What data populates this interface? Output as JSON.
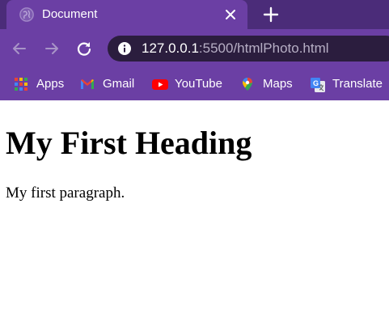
{
  "tab": {
    "title": "Document",
    "favicon": "globe-icon",
    "close_icon": "close-icon",
    "new_tab_icon": "plus-icon"
  },
  "toolbar": {
    "back_icon": "arrow-left-icon",
    "forward_icon": "arrow-right-icon",
    "reload_icon": "reload-icon",
    "url_host": "127.0.0.1",
    "url_rest": ":5500/htmlPhoto.html",
    "site_info_icon": "info-icon"
  },
  "bookmarks": [
    {
      "label": "Apps",
      "icon": "apps-grid-icon"
    },
    {
      "label": "Gmail",
      "icon": "gmail-icon"
    },
    {
      "label": "YouTube",
      "icon": "youtube-icon"
    },
    {
      "label": "Maps",
      "icon": "maps-pin-icon"
    },
    {
      "label": "Translate",
      "icon": "translate-icon"
    }
  ],
  "page": {
    "heading": "My First Heading",
    "paragraph": "My first paragraph."
  },
  "colors": {
    "frame_dark": "#4b2c79",
    "frame": "#6b3fa4",
    "omnibox": "#2b1d3e"
  }
}
